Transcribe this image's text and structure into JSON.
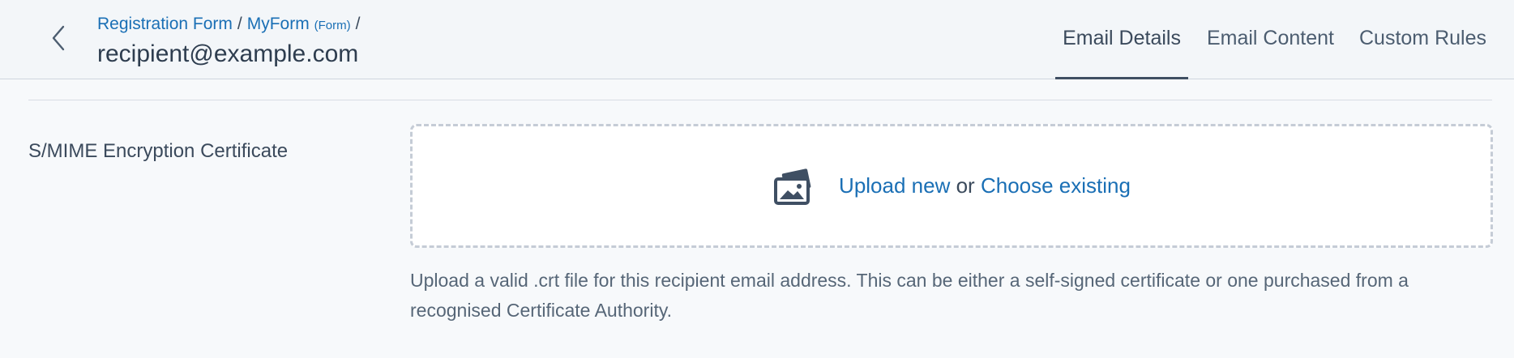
{
  "header": {
    "breadcrumb": {
      "item1": "Registration Form",
      "separator": "/",
      "item2": "MyForm",
      "item2_type": "(Form)"
    },
    "title": "recipient@example.com",
    "tabs": [
      {
        "label": "Email Details",
        "active": true
      },
      {
        "label": "Email Content",
        "active": false
      },
      {
        "label": "Custom Rules",
        "active": false
      }
    ],
    "back_icon": "chevron-left-icon"
  },
  "certificate": {
    "label": "S/MIME Encryption Certificate",
    "upload_icon": "images-icon",
    "upload_new": "Upload new",
    "or": "or",
    "choose_existing": "Choose existing",
    "help": "Upload a valid .crt file for this recipient email address. This can be either a self-signed certificate or one purchased from a recognised Certificate Authority."
  },
  "colors": {
    "link": "#1a6fb5",
    "header_bg": "#f3f6f9",
    "text": "#3b4a5c",
    "active_tab_underline": "#3f4f63"
  }
}
